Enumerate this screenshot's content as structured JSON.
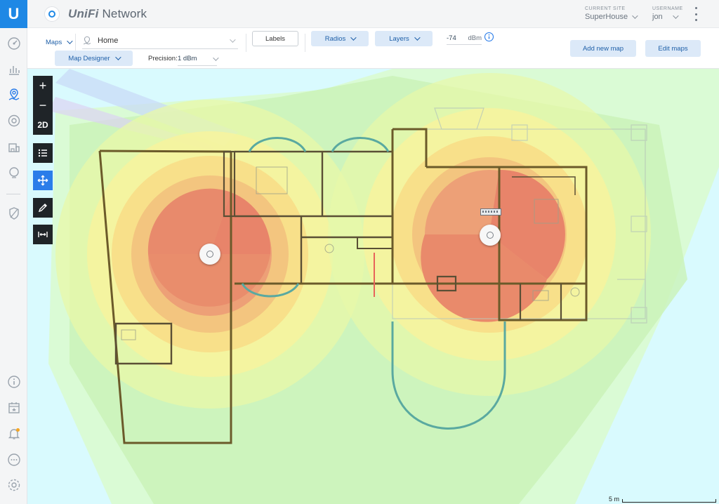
{
  "app": {
    "logo_letter": "U",
    "title_brand": "UniFi",
    "title_product": "Network"
  },
  "header": {
    "site_caption": "CURRENT SITE",
    "site_value": "SuperHouse",
    "user_caption": "USERNAME",
    "user_value": "jon"
  },
  "toolbar": {
    "maps_label": "Maps",
    "map_name": "Home",
    "labels_button": "Labels",
    "radios_button": "Radios",
    "layers_button": "Layers",
    "dbm_value": "-74",
    "dbm_unit": "dBm",
    "map_designer_button": "Map Designer",
    "precision_label": "Precision:",
    "precision_value": "1 dBm",
    "add_map_button": "Add new map",
    "edit_maps_button": "Edit maps"
  },
  "nav_icons": [
    "dashboard-icon",
    "statistics-icon",
    "map-icon",
    "devices-icon",
    "clients-icon",
    "insights-icon",
    "security-icon",
    "info-icon",
    "events-icon",
    "alerts-icon",
    "chat-icon",
    "settings-icon"
  ],
  "map_tools": {
    "zoom_in": "+",
    "zoom_out": "−",
    "view_mode": "2D"
  },
  "scale": {
    "label": "5 m"
  },
  "colors": {
    "accent": "#1e88e5",
    "heat_strong": "#e8846a",
    "heat_mid": "#f8d36a",
    "heat_weak": "#cff5a3",
    "heat_none": "#d9fafe"
  }
}
